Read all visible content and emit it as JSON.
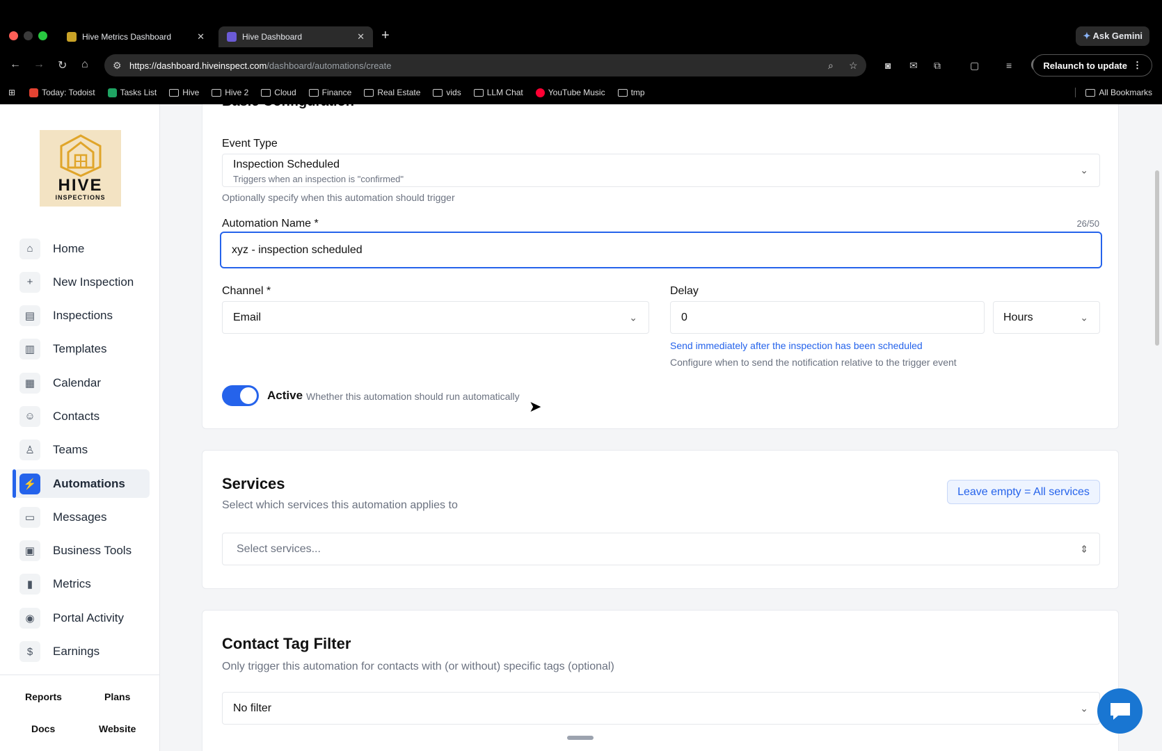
{
  "browser": {
    "tabs": [
      {
        "title": "Hive Metrics Dashboard",
        "active": false
      },
      {
        "title": "Hive Dashboard",
        "active": true
      }
    ],
    "gemini_label": "Ask Gemini",
    "url_host": "https://dashboard.hiveinspect.com",
    "url_path": "/dashboard/automations/create",
    "relaunch_label": "Relaunch to update",
    "bookmarks": [
      "Today: Todoist",
      "Tasks List",
      "Hive",
      "Hive 2",
      "Cloud",
      "Finance",
      "Real Estate",
      "vids",
      "LLM Chat",
      "YouTube Music",
      "tmp"
    ],
    "all_bookmarks": "All Bookmarks"
  },
  "sidebar": {
    "logo_word": "HIVE",
    "logo_sub": "INSPECTIONS",
    "items": [
      {
        "label": "Home",
        "icon": "home-icon",
        "glyph": "⌂"
      },
      {
        "label": "New Inspection",
        "icon": "plus-icon",
        "glyph": "+"
      },
      {
        "label": "Inspections",
        "icon": "dollar-document-icon",
        "glyph": "▤"
      },
      {
        "label": "Templates",
        "icon": "document-icon",
        "glyph": "▥"
      },
      {
        "label": "Calendar",
        "icon": "calendar-icon",
        "glyph": "▦"
      },
      {
        "label": "Contacts",
        "icon": "users-icon",
        "glyph": "☺"
      },
      {
        "label": "Teams",
        "icon": "user-check-icon",
        "glyph": "♙"
      },
      {
        "label": "Automations",
        "icon": "lightning-icon",
        "glyph": "⚡",
        "active": true
      },
      {
        "label": "Messages",
        "icon": "message-icon",
        "glyph": "▭"
      },
      {
        "label": "Business Tools",
        "icon": "briefcase-icon",
        "glyph": "▣"
      },
      {
        "label": "Metrics",
        "icon": "bar-chart-icon",
        "glyph": "▮"
      },
      {
        "label": "Portal Activity",
        "icon": "eye-icon",
        "glyph": "◉"
      },
      {
        "label": "Earnings",
        "icon": "dollar-icon",
        "glyph": "$"
      }
    ],
    "bottom_links": [
      "Reports",
      "Plans",
      "Docs",
      "Website"
    ]
  },
  "basic": {
    "heading": "Basic Configuration",
    "event_type_label": "Event Type",
    "event_type_value": "Inspection Scheduled",
    "event_type_desc": "Triggers when an inspection is \"confirmed\"",
    "event_type_hint": "Optionally specify when this automation should trigger",
    "name_label": "Automation Name *",
    "name_count": "26/50",
    "name_value": "xyz - inspection scheduled",
    "channel_label": "Channel *",
    "channel_value": "Email",
    "delay_label": "Delay",
    "delay_value": "0",
    "delay_unit": "Hours",
    "delay_info": "Send immediately after the inspection has been scheduled",
    "delay_hint": "Configure when to send the notification relative to the trigger event",
    "active_label": "Active",
    "active_desc": "Whether this automation should run automatically"
  },
  "services": {
    "title": "Services",
    "subtitle": "Select which services this automation applies to",
    "pill": "Leave empty = All services",
    "placeholder": "Select services..."
  },
  "tags": {
    "title": "Contact Tag Filter",
    "subtitle": "Only trigger this automation for contacts with (or without) specific tags (optional)",
    "value": "No filter"
  },
  "colors": {
    "accent": "#2563eb",
    "logo_bg": "#f3e3c3",
    "chat": "#1976d2"
  }
}
